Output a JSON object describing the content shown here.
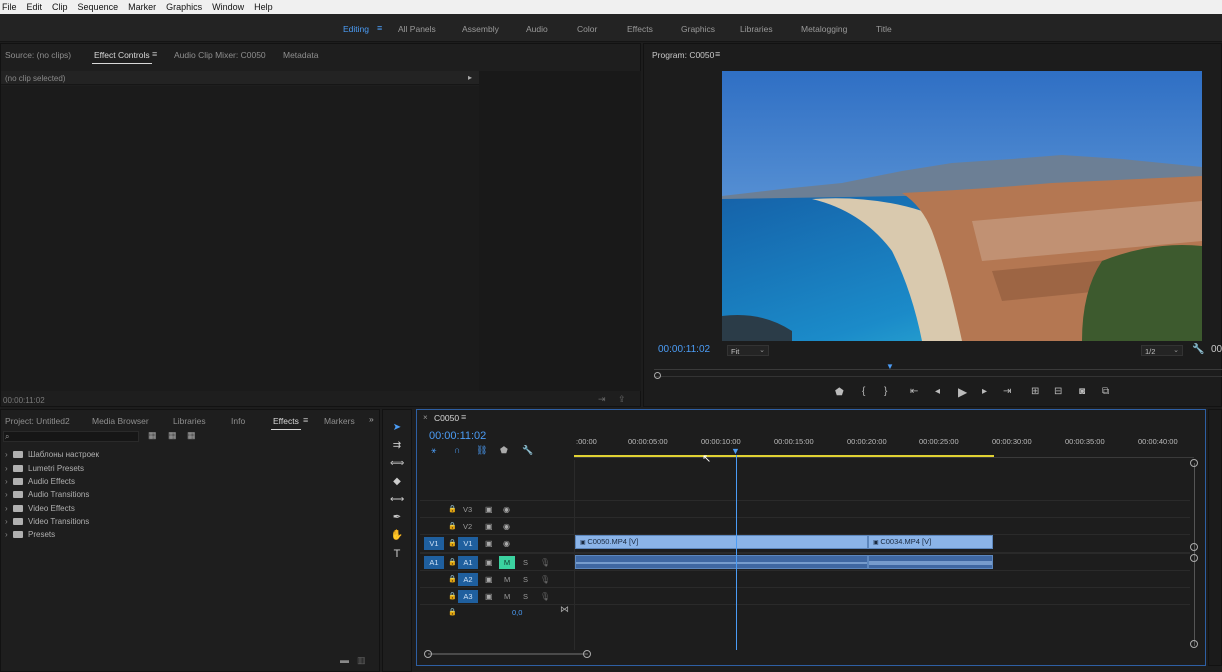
{
  "menu": [
    "File",
    "Edit",
    "Clip",
    "Sequence",
    "Marker",
    "Graphics",
    "Window",
    "Help"
  ],
  "workspaces": {
    "active": "Editing",
    "items": [
      "All Panels",
      "Assembly",
      "Audio",
      "Color",
      "Effects",
      "Graphics",
      "Libraries",
      "Metalogging",
      "Title"
    ]
  },
  "source_panel": {
    "tabs": [
      "Source: (no clips)",
      "Effect Controls",
      "Audio Clip Mixer: C0050",
      "Metadata"
    ],
    "active_tab": "Effect Controls",
    "no_clip": "(no clip selected)",
    "timecode": "00:00:11:02"
  },
  "program": {
    "title": "Program: C0050",
    "timecode": "00:00:11:02",
    "fit": "Fit",
    "resolution": "1/2",
    "right_timecode": "00"
  },
  "project_panel": {
    "tabs": [
      "Project: Untitled2",
      "Media Browser",
      "Libraries",
      "Info",
      "Effects",
      "Markers"
    ],
    "active_tab": "Effects",
    "search_icon": "search-icon",
    "items": [
      "Шаблоны настроек",
      "Lumetri Presets",
      "Audio Effects",
      "Audio Transitions",
      "Video Effects",
      "Video Transitions",
      "Presets"
    ]
  },
  "timeline": {
    "sequence": "C0050",
    "timecode": "00:00:11:02",
    "ruler": [
      ":00:00",
      "00:00:05:00",
      "00:00:10:00",
      "00:00:15:00",
      "00:00:20:00",
      "00:00:25:00",
      "00:00:30:00",
      "00:00:35:00",
      "00:00:40:00"
    ],
    "video_tracks": [
      "V3",
      "V2",
      "V1"
    ],
    "audio_tracks": [
      "A1",
      "A2",
      "A3"
    ],
    "source_patch_video": "V1",
    "source_patch_audio": "A1",
    "mute": "M",
    "solo": "S",
    "master_value": "0,0",
    "clips": [
      {
        "name": "C0050.MP4 [V]"
      },
      {
        "name": "C0034.MP4 [V]"
      }
    ]
  }
}
